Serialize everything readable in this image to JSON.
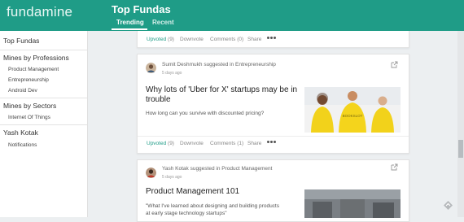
{
  "app": {
    "logo": "fundamine",
    "page_title": "Top Fundas"
  },
  "tabs": [
    {
      "label": "Trending",
      "active": true
    },
    {
      "label": "Recent",
      "active": false
    }
  ],
  "sidebar": {
    "sections": [
      {
        "heading": "Top Fundas",
        "items": []
      },
      {
        "heading": "Mines by Professions",
        "items": [
          "Product Management",
          "Entrepreneurship",
          "Android Dev"
        ]
      },
      {
        "heading": "Mines by Sectors",
        "items": [
          "Internet Of Things"
        ]
      },
      {
        "heading": "Yash Kotak",
        "items": [
          "Notifications"
        ]
      }
    ]
  },
  "feed": [
    {
      "actions": {
        "upvote": "Upvoted",
        "upvote_count": "(9)",
        "downvote": "Downvote",
        "comments": "Comments (0)",
        "share": "Share"
      }
    },
    {
      "author": "Sumit Deshmukh",
      "suggested_text": "suggested in",
      "category": "Entrepreneurship",
      "time": "5 days ago",
      "title": "Why lots of 'Uber for X' startups may be in trouble",
      "subtitle": "How long can you survive with discounted pricing?",
      "image_caption": "BOOKSLOT",
      "actions": {
        "upvote": "Upvoted",
        "upvote_count": "(9)",
        "downvote": "Downvote",
        "comments": "Comments (1)",
        "share": "Share"
      }
    },
    {
      "author": "Yash Kotak",
      "suggested_text": "suggested in",
      "category": "Product Management",
      "time": "5 days ago",
      "title": "Product Management 101",
      "subtitle_line1": "\"What I've learned about designing and building products",
      "subtitle_line2": "at early stage technology startups\""
    }
  ],
  "icons": [
    "open-external-icon",
    "more-options-icon",
    "scroll-corner-icon"
  ],
  "colors": {
    "brand": "#1f9c87",
    "upvoted": "#1f9c87",
    "background": "#eceff1"
  }
}
